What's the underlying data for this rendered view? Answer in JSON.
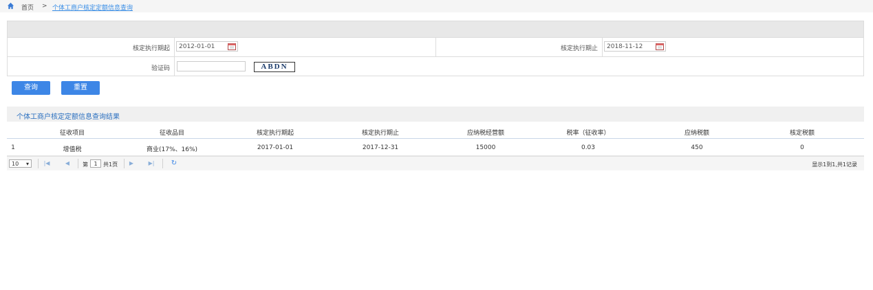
{
  "breadcrumb": {
    "home_icon": "home-icon",
    "home_label": "首页",
    "separator": ">",
    "current": "个体工商户核定定额信息查询"
  },
  "form": {
    "start_label": "核定执行期起",
    "start_value": "2012-01-01",
    "end_label": "核定执行期止",
    "end_value": "2018-11-12",
    "captcha_label": "验证码",
    "captcha_value": "",
    "captcha_image_text": "ABDN",
    "calendar_icon": "calendar-icon"
  },
  "buttons": {
    "query_label": "查询",
    "reset_label": "重置"
  },
  "results": {
    "title": "个体工商户核定定额信息查询结果",
    "columns": [
      "征收项目",
      "征收品目",
      "核定执行期起",
      "核定执行期止",
      "应纳税经营额",
      "税率（征收率）",
      "应纳税额",
      "核定税额"
    ],
    "rows": [
      {
        "index": "1",
        "cells": [
          "增值税",
          "商业(17%、16%)",
          "2017-01-01",
          "2017-12-31",
          "15000",
          "0.03",
          "450",
          "0"
        ]
      }
    ]
  },
  "pager": {
    "page_size": "10",
    "page_label_prefix": "第",
    "current_page": "1",
    "page_label_suffix": "共1页",
    "info": "显示1到1,共1记录",
    "icons": [
      "first-page-icon",
      "prev-page-icon",
      "next-page-icon",
      "last-page-icon",
      "refresh-icon"
    ]
  },
  "colors": {
    "accent": "#3d86e6",
    "title_blue": "#2a6fbf",
    "link": "#3a8ee6"
  }
}
